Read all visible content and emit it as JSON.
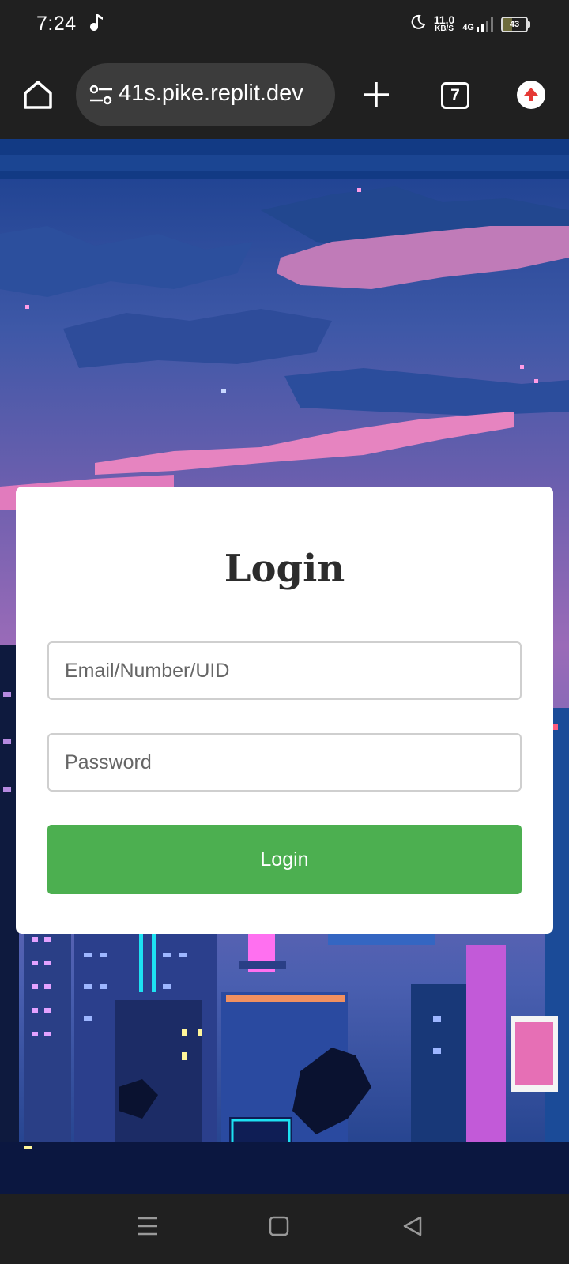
{
  "status_bar": {
    "time": "7:24",
    "net_speed_value": "11.0",
    "net_speed_unit": "KB/S",
    "network_type": "4G",
    "battery": "43"
  },
  "browser": {
    "url": "41s.pike.replit.dev",
    "tab_count": "7"
  },
  "login": {
    "title": "Login",
    "email_placeholder": "Email/Number/UID",
    "password_placeholder": "Password",
    "button_label": "Login",
    "button_color": "#4caf50"
  },
  "icons": {
    "home": "home-icon",
    "site_settings": "tune-icon",
    "new_tab": "plus-icon",
    "tabs": "tabs-icon",
    "update": "update-icon",
    "nav_menu": "menu-icon",
    "nav_home": "square-icon",
    "nav_back": "back-triangle-icon"
  }
}
